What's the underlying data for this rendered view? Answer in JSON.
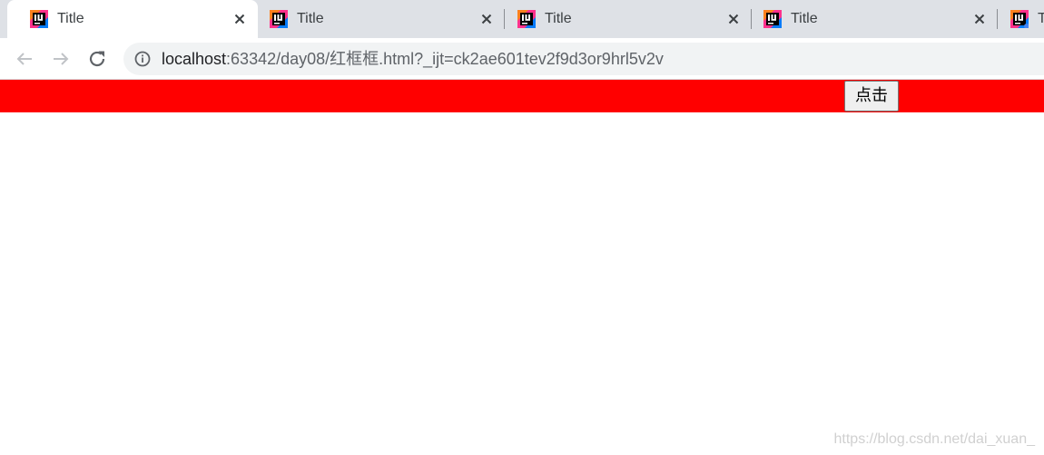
{
  "tabs": [
    {
      "title": "Title",
      "active": true
    },
    {
      "title": "Title",
      "active": false
    },
    {
      "title": "Title",
      "active": false
    },
    {
      "title": "Title",
      "active": false
    },
    {
      "title": "T",
      "active": false
    }
  ],
  "address_bar": {
    "host": "localhost",
    "rest": ":63342/day08/红框框.html?_ijt=ck2ae601tev2f9d3or9hrl5v2v"
  },
  "page": {
    "bar_color": "#ff0000",
    "button_label": "点击"
  },
  "watermark": "https://blog.csdn.net/dai_xuan_",
  "icons": {
    "favicon": "intellij-icon",
    "back": "arrow-left-icon",
    "forward": "arrow-right-icon",
    "reload": "reload-icon",
    "info": "info-icon",
    "close": "close-icon"
  }
}
